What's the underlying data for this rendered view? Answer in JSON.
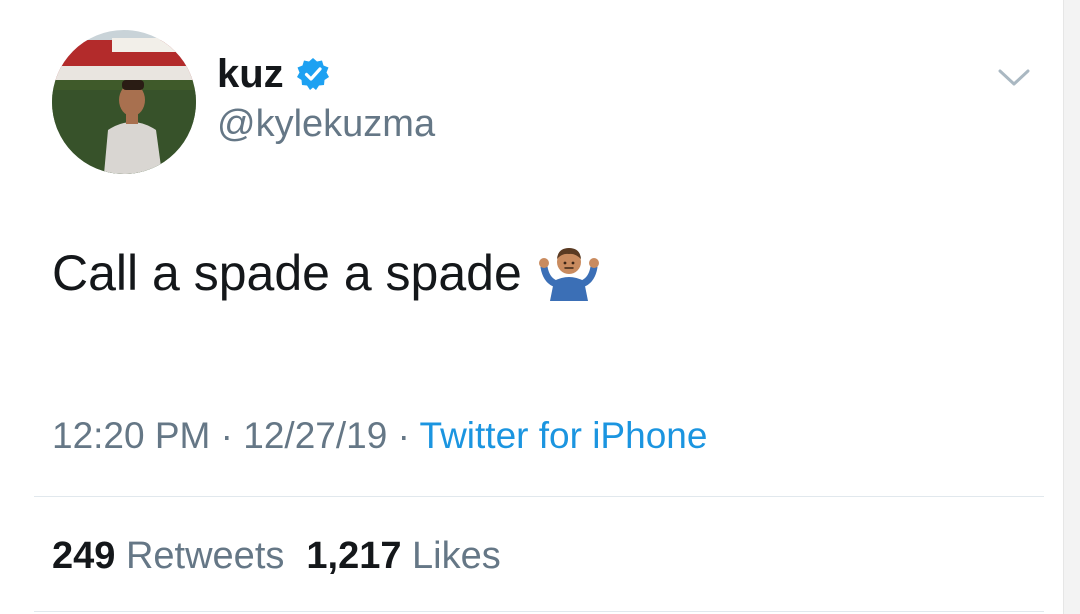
{
  "tweet": {
    "display_name": "kuz",
    "handle": "@kylekuzma",
    "verified": true,
    "text": "Call a spade a spade",
    "emoji": "shrug-icon",
    "time": "12:20 PM",
    "separator": " · ",
    "date": "12/27/19",
    "source": "Twitter for iPhone",
    "retweets_count": "249",
    "retweets_label": "Retweets",
    "likes_count": "1,217",
    "likes_label": "Likes"
  },
  "colors": {
    "primary_text": "#14171a",
    "secondary_text": "#657786",
    "link": "#1b95e0",
    "verified_badge": "#1da1f2",
    "divider": "#e1e8ed"
  },
  "icons": {
    "verified": "verified-badge-icon",
    "more": "chevron-down-icon",
    "avatar": "avatar"
  }
}
